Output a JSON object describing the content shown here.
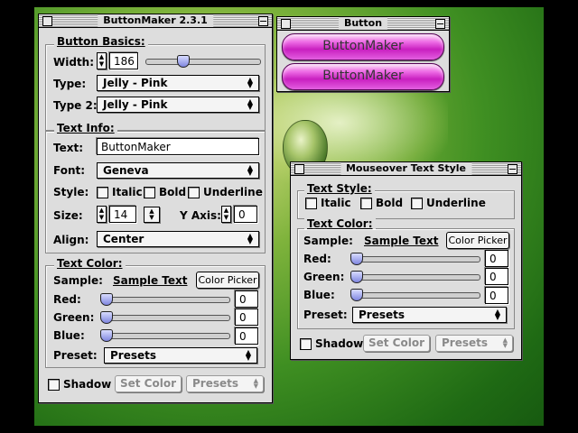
{
  "main_window": {
    "title": "ButtonMaker 2.3.1",
    "basics": {
      "title": "Button Basics:",
      "width_label": "Width:",
      "width_value": "186",
      "type_label": "Type:",
      "type_value": "Jelly - Pink",
      "type2_label": "Type 2:",
      "type2_value": "Jelly - Pink",
      "width_slider_level": 0.33
    },
    "text_info": {
      "title": "Text Info:",
      "text_label": "Text:",
      "text_value": "ButtonMaker",
      "font_label": "Font:",
      "font_value": "Geneva",
      "style_label": "Style:",
      "italic_label": "Italic",
      "bold_label": "Bold",
      "underline_label": "Underline",
      "size_label": "Size:",
      "size_value": "14",
      "yaxis_label": "Y Axis:",
      "yaxis_value": "0",
      "align_label": "Align:",
      "align_value": "Center"
    },
    "text_color": {
      "title": "Text Color:",
      "sample_label": "Sample:",
      "sample_text": "Sample Text",
      "color_picker_label": "Color Picker",
      "red_label": "Red:",
      "red_value": "0",
      "green_label": "Green:",
      "green_value": "0",
      "blue_label": "Blue:",
      "blue_value": "0",
      "preset_label": "Preset:",
      "preset_value": "Presets"
    },
    "bottom": {
      "shadow_label": "Shadow",
      "set_color_label": "Set Color",
      "presets_label": "Presets"
    }
  },
  "button_window": {
    "title": "Button",
    "button1_label": "ButtonMaker",
    "button2_label": "ButtonMaker"
  },
  "mouseover_window": {
    "title": "Mouseover Text Style",
    "text_style_title": "Text Style:",
    "italic_label": "Italic",
    "bold_label": "Bold",
    "underline_label": "Underline",
    "text_color_title": "Text Color:",
    "sample_label": "Sample:",
    "sample_text": "Sample Text",
    "color_picker_label": "Color Picker",
    "red_label": "Red:",
    "red_value": "0",
    "green_label": "Green:",
    "green_value": "0",
    "blue_label": "Blue:",
    "blue_value": "0",
    "preset_label": "Preset:",
    "preset_value": "Presets",
    "shadow_label": "Shadow",
    "set_color_label": "Set Color",
    "presets_label": "Presets"
  },
  "icons": {
    "popup_arrows": "updown-arrows-icon",
    "window_close": "close-box-icon",
    "window_zoom": "zoom-box-icon"
  },
  "colors": {
    "jelly_pink": "#d42bd0",
    "slider_thumb": "#8f96ea",
    "window_bg": "#dddddd"
  }
}
